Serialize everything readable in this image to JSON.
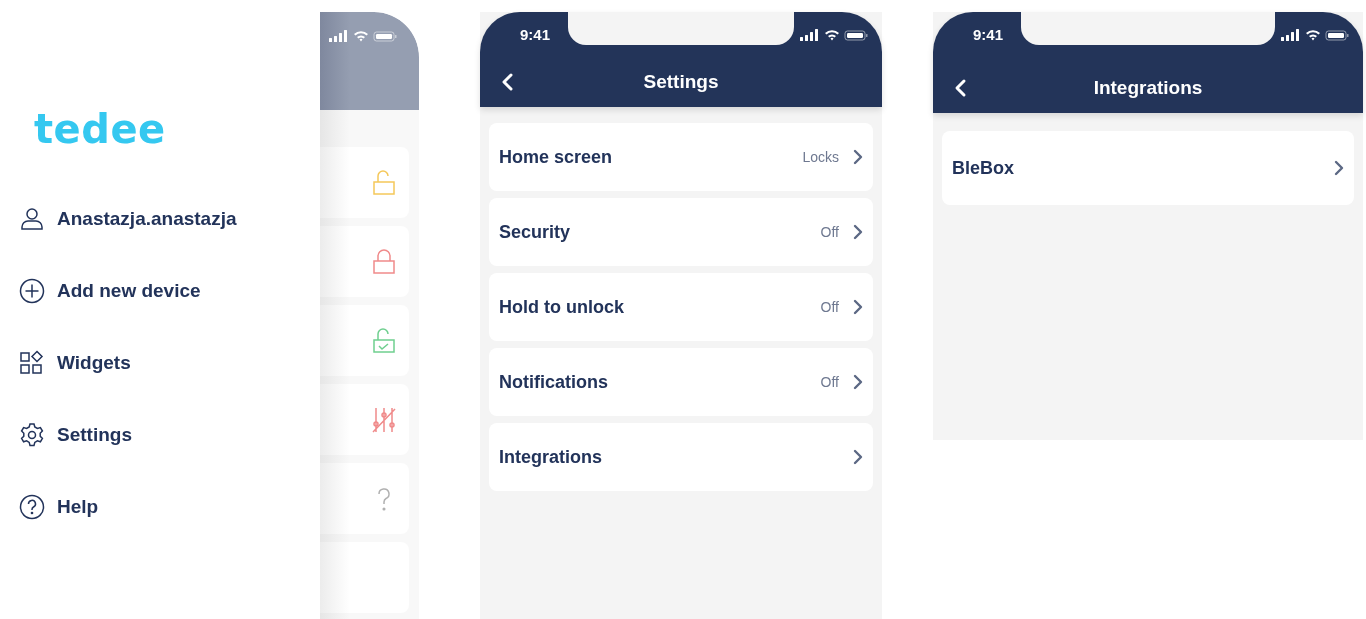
{
  "drawer": {
    "logo": "tedee",
    "items": [
      {
        "kind": "user",
        "label": "Anastazja.anastazja"
      },
      {
        "kind": "add",
        "label": "Add new device"
      },
      {
        "kind": "widgets",
        "label": "Widgets"
      },
      {
        "kind": "settings",
        "label": "Settings"
      },
      {
        "kind": "help",
        "label": "Help"
      }
    ]
  },
  "background_screen": {
    "cards": [
      {
        "kind": "unlocked"
      },
      {
        "kind": "locked"
      },
      {
        "kind": "unlocked-check"
      },
      {
        "kind": "sliders"
      },
      {
        "kind": "question"
      },
      {
        "kind": "empty"
      }
    ]
  },
  "settings_screen": {
    "time": "9:41",
    "title": "Settings",
    "rows": [
      {
        "label": "Home screen",
        "value": "Locks"
      },
      {
        "label": "Security",
        "value": "Off"
      },
      {
        "label": "Hold to unlock",
        "value": "Off"
      },
      {
        "label": "Notifications",
        "value": "Off"
      },
      {
        "label": "Integrations"
      }
    ]
  },
  "integrations_screen": {
    "time": "9:41",
    "title": "Integrations",
    "rows": [
      {
        "label": "BleBox"
      }
    ]
  }
}
